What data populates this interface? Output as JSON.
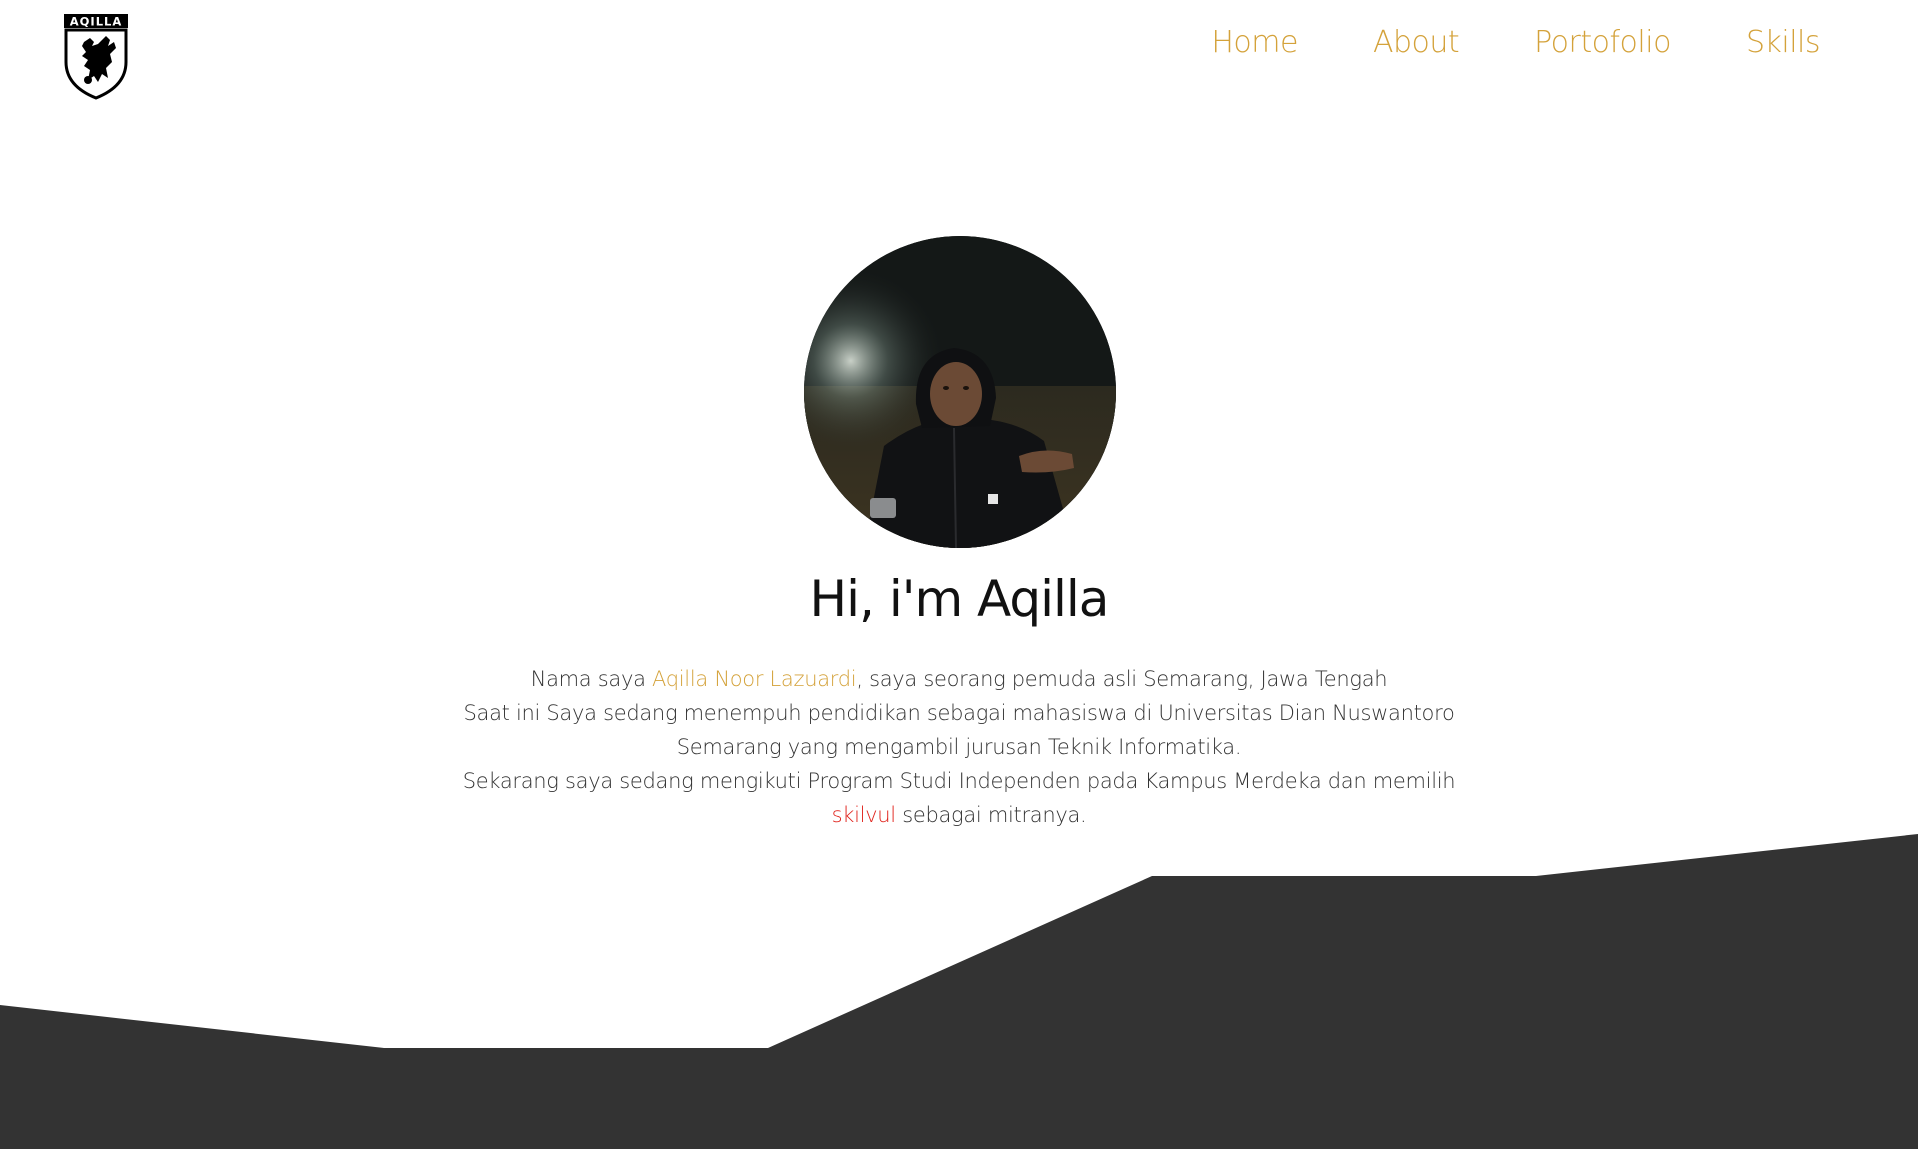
{
  "header": {
    "logo_text": "AQILLA",
    "nav": [
      {
        "label": "Home"
      },
      {
        "label": "About"
      },
      {
        "label": "Portofolio"
      },
      {
        "label": "Skills"
      }
    ]
  },
  "hero": {
    "title": "Hi, i'm Aqilla",
    "bio": {
      "line1_prefix": "Nama saya ",
      "name": "Aqilla Noor Lazuardi",
      "line1_suffix": ", saya seorang pemuda asli Semarang, Jawa Tengah",
      "line2": "Saat ini Saya sedang menempuh pendidikan sebagai mahasiswa di Universitas Dian Nuswantoro Semarang yang mengambil jurusan Teknik Informatika.",
      "line3_prefix": "Sekarang saya sedang mengikuti Program Studi Independen pada Kampus Merdeka dan memilih ",
      "brand": "skilvul",
      "line3_suffix": " sebagai mitranya."
    }
  },
  "colors": {
    "accent": "#d4a23a",
    "brand_red": "#e0231c",
    "footer_dark": "#333333",
    "text_dark": "#111111"
  },
  "icons": {
    "logo": "griffin-shield-icon"
  }
}
